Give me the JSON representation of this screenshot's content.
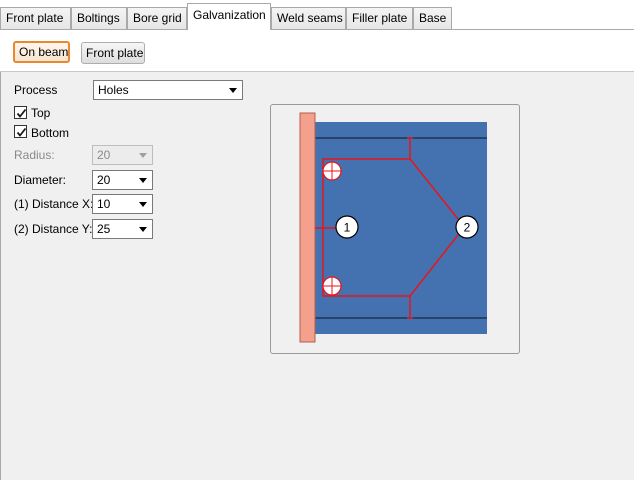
{
  "tabs": [
    {
      "label": "Front plate",
      "active": false
    },
    {
      "label": "Boltings",
      "active": false
    },
    {
      "label": "Bore grid",
      "active": false
    },
    {
      "label": "Galvanization",
      "active": true
    },
    {
      "label": "Weld seams",
      "active": false
    },
    {
      "label": "Filler plate",
      "active": false
    },
    {
      "label": "Base",
      "active": false
    }
  ],
  "toolbar": {
    "on_beam_label": "On beam",
    "front_plate_label": "Front plate"
  },
  "form": {
    "process_label": "Process",
    "process_value": "Holes",
    "top_label": "Top",
    "top_checked": true,
    "bottom_label": "Bottom",
    "bottom_checked": true,
    "radius_label": "Radius:",
    "radius_value": "20",
    "diameter_label": "Diameter:",
    "diameter_value": "20",
    "distance_x_label": "(1) Distance X:",
    "distance_x_value": "10",
    "distance_y_label": "(2) Distance Y:",
    "distance_y_value": "25"
  },
  "preview": {
    "marker_1": "1",
    "marker_2": "2",
    "colors": {
      "beam": "#4472b0",
      "plate": "#f4a08c",
      "dimension": "#e8151b"
    }
  }
}
